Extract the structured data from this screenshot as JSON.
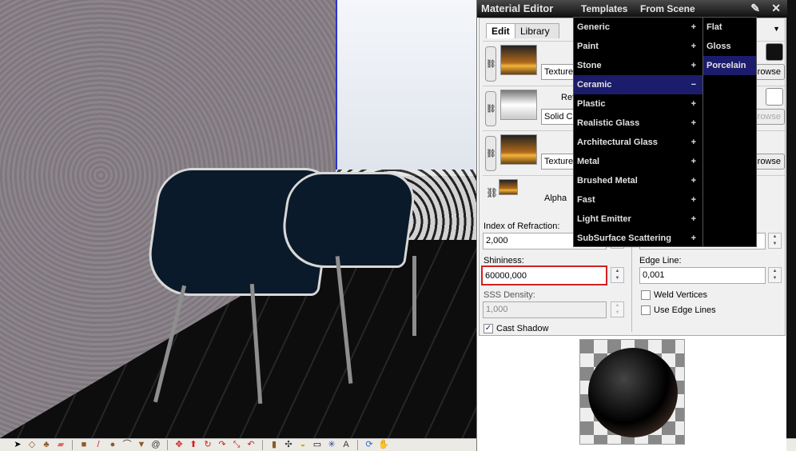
{
  "panel": {
    "title": "Material Editor",
    "menu_templates": "Templates",
    "menu_from_scene": "From Scene",
    "tabs": [
      "Edit",
      "Library"
    ],
    "rows": [
      {
        "select": "Texture",
        "button": "Browse",
        "swatch": "#111111"
      },
      {
        "label": "Refl",
        "select": "Solid Co",
        "button": "Browse",
        "swatch": "#ffffff"
      },
      {
        "select": "Texture",
        "button": "Browse"
      }
    ],
    "alpha_label": "Alpha",
    "ior_label": "Index of Refraction:",
    "ior_value": "2,000",
    "shininess_label": "Shininess:",
    "shininess_value": "60000,000",
    "sss_label": "SSS Density:",
    "sss_value": "1,000",
    "cast_shadow_label": "Cast Shadow",
    "cast_shadow_checked": true,
    "edge_line_label": "Edge Line:",
    "edge_line_value": "0,001",
    "weld_vertices_label": "Weld Vertices",
    "use_edge_lines_label": "Use Edge Lines"
  },
  "templates_menu": {
    "items": [
      {
        "label": "Generic",
        "sign": "+"
      },
      {
        "label": "Paint",
        "sign": "+"
      },
      {
        "label": "Stone",
        "sign": "+"
      },
      {
        "label": "Ceramic",
        "sign": "−",
        "highlighted": true
      },
      {
        "label": "Plastic",
        "sign": "+"
      },
      {
        "label": "Realistic Glass",
        "sign": "+"
      },
      {
        "label": "Architectural Glass",
        "sign": "+"
      },
      {
        "label": "Metal",
        "sign": "+"
      },
      {
        "label": "Brushed Metal",
        "sign": "+"
      },
      {
        "label": "Fast",
        "sign": "+"
      },
      {
        "label": "Light Emitter",
        "sign": "+"
      },
      {
        "label": "SubSurface Scattering",
        "sign": "+"
      }
    ],
    "submenu": [
      {
        "label": "Flat"
      },
      {
        "label": "Gloss"
      },
      {
        "label": "Porcelain",
        "highlighted": true
      }
    ]
  },
  "colors": {
    "highlight": "#1c1c6c",
    "focus_border": "#d42020"
  }
}
